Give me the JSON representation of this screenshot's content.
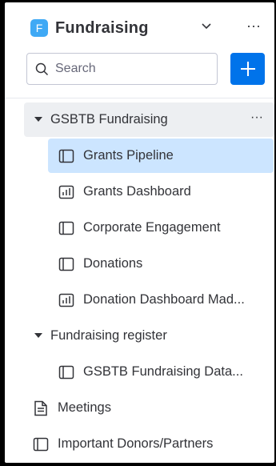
{
  "workspace": {
    "badge_letter": "F",
    "title": "Fundraising",
    "more_label": "···"
  },
  "search": {
    "placeholder": "Search",
    "add_label": "+"
  },
  "tree": {
    "folder1": {
      "label": "GSBTB Fundraising",
      "more_label": "···",
      "items": [
        {
          "label": "Grants Pipeline",
          "icon": "board-icon",
          "selected": true
        },
        {
          "label": "Grants Dashboard",
          "icon": "dashboard-icon"
        },
        {
          "label": "Corporate Engagement",
          "icon": "board-icon"
        },
        {
          "label": "Donations",
          "icon": "board-icon"
        },
        {
          "label": "Donation Dashboard Mad...",
          "icon": "dashboard-icon"
        }
      ]
    },
    "folder2": {
      "label": "Fundraising register",
      "items": [
        {
          "label": "GSBTB Fundraising Data...",
          "icon": "board-icon"
        }
      ]
    },
    "top_items": [
      {
        "label": "Meetings",
        "icon": "doc-icon"
      },
      {
        "label": "Important Donors/Partners",
        "icon": "board-icon"
      }
    ]
  },
  "colors": {
    "accent": "#0073ea",
    "badge": "#3fa9f5",
    "selected_bg": "#cce5ff"
  }
}
